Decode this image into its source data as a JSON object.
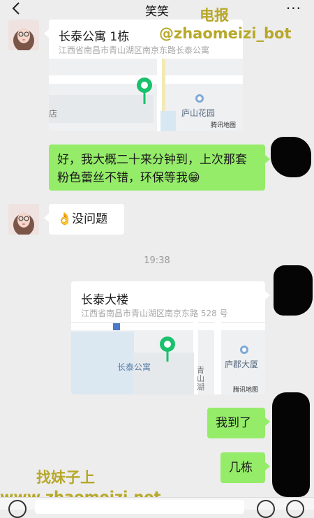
{
  "header": {
    "title": "笑笑",
    "more": "···"
  },
  "messages": {
    "loc1": {
      "title": "长泰公寓 1栋",
      "address": "江西省南昌市青山湖区南京东路长泰公寓",
      "map_labels": {
        "shop": "店",
        "poi": "庐山花园",
        "provider": "腾讯地图"
      }
    },
    "msg1": {
      "text": "好，我大概二十来分钟到，上次那套粉色蕾丝不错，环保等我😁"
    },
    "msg2": {
      "text": "👌没问题"
    },
    "time": "19:38",
    "loc2": {
      "title": "长泰大楼",
      "address": "江西省南昌市青山湖区南京东路 528 号",
      "map_labels": {
        "area": "长泰公寓",
        "road": "青山湖",
        "poi": "庐郡大厦",
        "provider": "腾讯地图"
      }
    },
    "msg3": {
      "text": "我到了"
    },
    "msg4": {
      "text": "几栋"
    }
  },
  "watermarks": {
    "top_line1": "电报",
    "top_line2": "@zhaomeizi_bot",
    "bottom_line1": "找妹子上",
    "bottom_line2": "www.zhaomeizi.net"
  },
  "colors": {
    "green_bubble": "#95ec69",
    "pin_green": "#19c16c",
    "watermark": "#b7a82a"
  }
}
